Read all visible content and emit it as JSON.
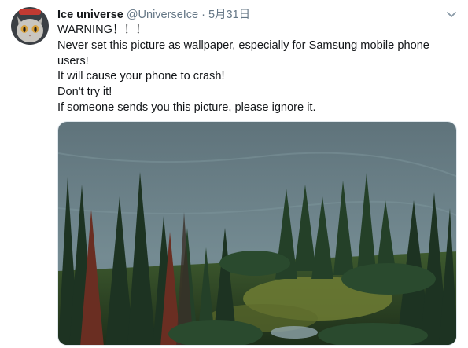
{
  "author": {
    "name": "Ice universe",
    "handle": "@UniverseIce",
    "separator": "·",
    "date": "5月31日"
  },
  "tweet": {
    "lines": [
      "WARNING！！！",
      "Never set this picture as wallpaper, especially for Samsung mobile phone users!",
      "It will cause your phone to crash!",
      "Don't try it!",
      "If someone sends you this picture, please ignore it."
    ]
  },
  "icons": {
    "avatar": "cat-avatar",
    "caret": "chevron-down-icon"
  },
  "colors": {
    "name": "#14171a",
    "secondary": "#657786",
    "lake": "#6d848c",
    "forest": "#1f3a24"
  }
}
